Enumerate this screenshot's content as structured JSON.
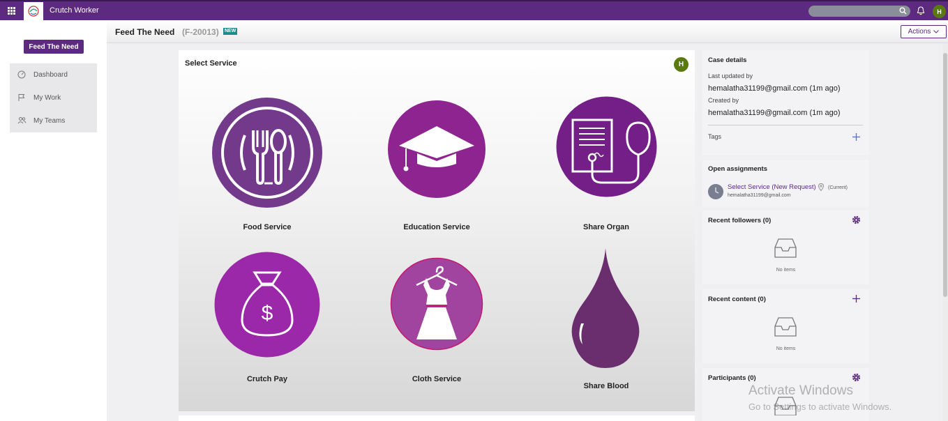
{
  "topbar": {
    "app_title": "Crutch Worker",
    "avatar_initial": "H"
  },
  "leftnav": {
    "case_button": "Feed The Need",
    "items": [
      {
        "label": "Dashboard",
        "icon": "dashboard-icon"
      },
      {
        "label": "My Work",
        "icon": "flag-icon"
      },
      {
        "label": "My Teams",
        "icon": "users-icon"
      }
    ]
  },
  "header": {
    "title": "Feed The Need",
    "case_id": "(F-20013)",
    "badge": "NEW",
    "actions_label": "Actions"
  },
  "main": {
    "section_title": "Select Service",
    "avatar_initial": "H",
    "services": [
      {
        "label": "Food Service",
        "icon": "fork-spoon-plate-icon"
      },
      {
        "label": "Education Service",
        "icon": "graduation-cap-icon"
      },
      {
        "label": "Share Organ",
        "icon": "medical-report-stethoscope-icon"
      },
      {
        "label": "Crutch Pay",
        "icon": "money-bag-icon"
      },
      {
        "label": "Cloth Service",
        "icon": "dress-hanger-icon"
      },
      {
        "label": "Share Blood",
        "icon": "blood-drop-icon"
      }
    ]
  },
  "case_details": {
    "title": "Case details",
    "last_updated_label": "Last updated by",
    "last_updated_value": "hemalatha31199@gmail.com (1m ago)",
    "created_label": "Created by",
    "created_value": "hemalatha31199@gmail.com (1m ago)",
    "tags_label": "Tags"
  },
  "open_assignments": {
    "title": "Open assignments",
    "link": "Select Service (New Request)",
    "status": "(Current)",
    "email": "hemalatha31199@gmail.com"
  },
  "recent_followers": {
    "title": "Recent followers",
    "count": "(0)",
    "empty": "No items"
  },
  "recent_content": {
    "title": "Recent content",
    "count": "(0)",
    "empty": "No items"
  },
  "participants": {
    "title": "Participants",
    "count": "(0)"
  },
  "watermark": {
    "line1": "Activate Windows",
    "line2": "Go to Settings to activate Windows."
  },
  "colors": {
    "brand_purple": "#5c2a7e",
    "food_circle": "#733a8c",
    "education_circle": "#8e2490",
    "organ_circle": "#731f87",
    "pay_circle": "#9b28a8",
    "cloth_circle": "#a044a0",
    "blood_drop": "#6a2d6e",
    "avatar_green": "#5a7a10",
    "new_badge": "#1f8a88"
  }
}
